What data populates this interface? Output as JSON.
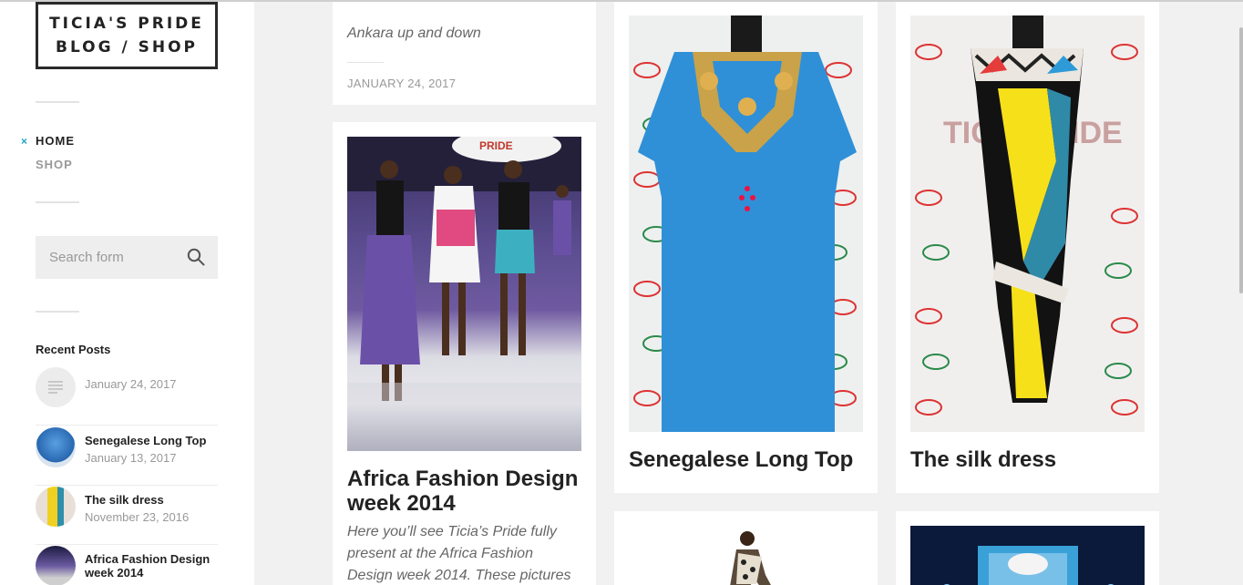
{
  "site": {
    "logo_line1": "TICIA'S PRIDE",
    "logo_line2": "BLOG / SHOP"
  },
  "nav": {
    "home": "HOME",
    "shop": "SHOP",
    "active_marker": "×"
  },
  "search": {
    "placeholder": "Search form",
    "value": ""
  },
  "recent": {
    "title": "Recent Posts",
    "items": [
      {
        "title": "",
        "date": "January 24, 2017"
      },
      {
        "title": "Senegalese Long Top",
        "date": "January 13, 2017"
      },
      {
        "title": "The silk dress",
        "date": "November 23, 2016"
      },
      {
        "title": "Africa Fashion Design week 2014",
        "date": ""
      }
    ]
  },
  "posts": {
    "first": {
      "excerpt": "Ankara up and down",
      "date": "JANUARY 24, 2017"
    },
    "africa": {
      "title": "Africa Fashion Design week 2014",
      "excerpt": "Here you’ll see Ticia’s Pride fully present at the Africa Fashion Design week 2014. These pictures"
    },
    "senegalese": {
      "title": "Senegalese Long Top"
    },
    "silk": {
      "title": "The silk dress"
    }
  },
  "colors": {
    "accent": "#1fa3c8",
    "bg": "#f1f1f1"
  }
}
